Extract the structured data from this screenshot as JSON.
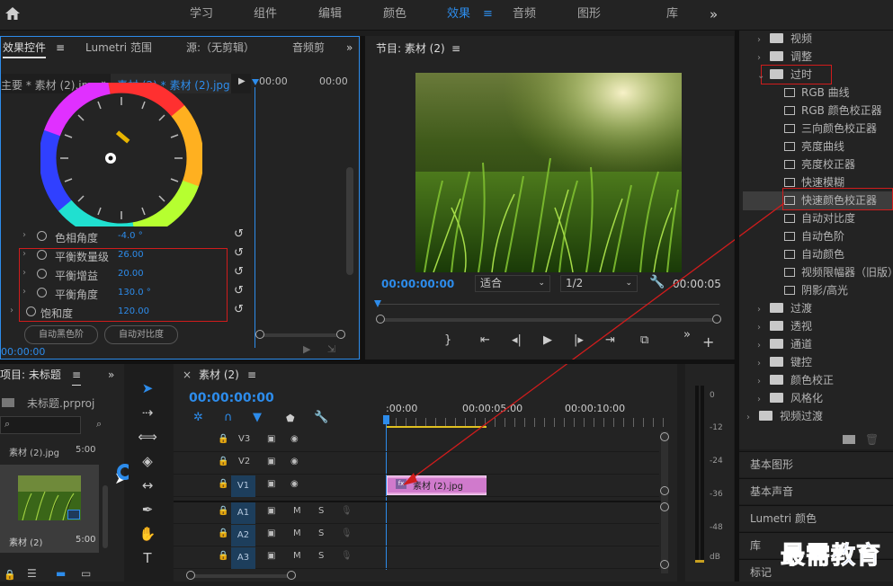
{
  "topbar": {
    "home_icon": "home-icon",
    "workspaces": [
      "学习",
      "组件",
      "编辑",
      "颜色",
      "效果",
      "音频",
      "图形",
      "库"
    ],
    "active": "效果",
    "more": "»"
  },
  "effect_controls": {
    "tabs": [
      "效果控件",
      "Lumetri 范围",
      "源:（无剪辑）",
      "音频剪"
    ],
    "overflow": "»",
    "master_label": "主要 * 素材 (2).jpg",
    "clip_label": "素材 (2) * 素材 (2).jpg",
    "time_left": "00:00",
    "time_right": "00:00",
    "properties": [
      {
        "label": "色相角度",
        "value": "-4.0 °"
      },
      {
        "label": "平衡数量级",
        "value": "26.00"
      },
      {
        "label": "平衡增益",
        "value": "20.00"
      },
      {
        "label": "平衡角度",
        "value": "130.0 °"
      },
      {
        "label": "饱和度",
        "value": "120.00"
      }
    ],
    "buttons": [
      "自动黑色阶",
      "自动对比度"
    ],
    "timecode": "00:00:00"
  },
  "program": {
    "title": "节目: 素材 (2)",
    "timecode": "00:00:00:00",
    "fit": "适合",
    "resolution": "1/2",
    "duration": "00:00:05"
  },
  "effects_tree": {
    "items": [
      {
        "label": "视频",
        "type": "folder"
      },
      {
        "label": "调整",
        "type": "folder"
      },
      {
        "label": "过时",
        "type": "folder-open"
      },
      {
        "label": "RGB 曲线",
        "type": "effect"
      },
      {
        "label": "RGB 颜色校正器",
        "type": "effect"
      },
      {
        "label": "三向颜色校正器",
        "type": "effect"
      },
      {
        "label": "亮度曲线",
        "type": "effect"
      },
      {
        "label": "亮度校正器",
        "type": "effect"
      },
      {
        "label": "快速模糊",
        "type": "effect"
      },
      {
        "label": "快速颜色校正器",
        "type": "effect"
      },
      {
        "label": "自动对比度",
        "type": "effect"
      },
      {
        "label": "自动色阶",
        "type": "effect"
      },
      {
        "label": "自动颜色",
        "type": "effect"
      },
      {
        "label": "视频限幅器（旧版）",
        "type": "effect"
      },
      {
        "label": "阴影/高光",
        "type": "effect"
      },
      {
        "label": "过渡",
        "type": "folder"
      },
      {
        "label": "透视",
        "type": "folder"
      },
      {
        "label": "通道",
        "type": "folder"
      },
      {
        "label": "键控",
        "type": "folder"
      },
      {
        "label": "颜色校正",
        "type": "folder"
      },
      {
        "label": "风格化",
        "type": "folder"
      },
      {
        "label": "视频过渡",
        "type": "folder"
      }
    ],
    "panels": [
      "基本图形",
      "基本声音",
      "Lumetri 颜色",
      "库",
      "标记"
    ],
    "watermark": "最需教育"
  },
  "project": {
    "title": "项目: 未标题",
    "file": "未标题.prproj",
    "item1_name": "素材 (2).jpg",
    "item1_dur": "5:00",
    "item2_name": "素材 (2)",
    "item2_dur": "5:00"
  },
  "timeline": {
    "tab": "素材 (2)",
    "timecode": "00:00:00:00",
    "ruler": [
      ":00:00",
      "00:00:05:00",
      "00:00:10:00"
    ],
    "video_tracks": [
      "V3",
      "V2",
      "V1"
    ],
    "audio_tracks": [
      "A1",
      "A2",
      "A3"
    ],
    "clip_label": "素材 (2).jpg",
    "fx": "fx",
    "m": "M",
    "s": "S"
  },
  "meter": {
    "labels": [
      "0",
      "-12",
      "-24",
      "-36",
      "-48",
      "dB"
    ]
  }
}
